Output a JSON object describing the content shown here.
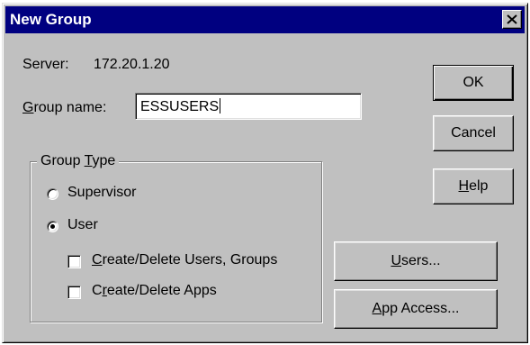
{
  "window": {
    "title": "New Group",
    "close_glyph": "✕"
  },
  "server": {
    "label": "Server:",
    "value": "172.20.1.20"
  },
  "group_name": {
    "label_mnemonic": "G",
    "label_rest": "roup name:",
    "value": "ESSUSERS"
  },
  "group_type": {
    "legend_prefix": "Group ",
    "legend_mnemonic": "T",
    "legend_rest": "ype",
    "options": [
      {
        "label": "Supervisor",
        "selected": false
      },
      {
        "label": "User",
        "selected": true
      }
    ],
    "permissions": [
      {
        "mnemonic": "C",
        "rest": "reate/Delete Users, Groups",
        "checked": false
      },
      {
        "pre": "C",
        "mnemonic": "r",
        "rest": "eate/Delete Apps",
        "checked": false
      }
    ]
  },
  "buttons": {
    "ok": "OK",
    "cancel": "Cancel",
    "help_mnemonic": "H",
    "help_rest": "elp",
    "users_mnemonic": "U",
    "users_rest": "sers...",
    "app_access_mnemonic": "A",
    "app_access_rest": "pp Access..."
  },
  "colors": {
    "face": "#c0c0c0",
    "titlebar": "#000080"
  }
}
